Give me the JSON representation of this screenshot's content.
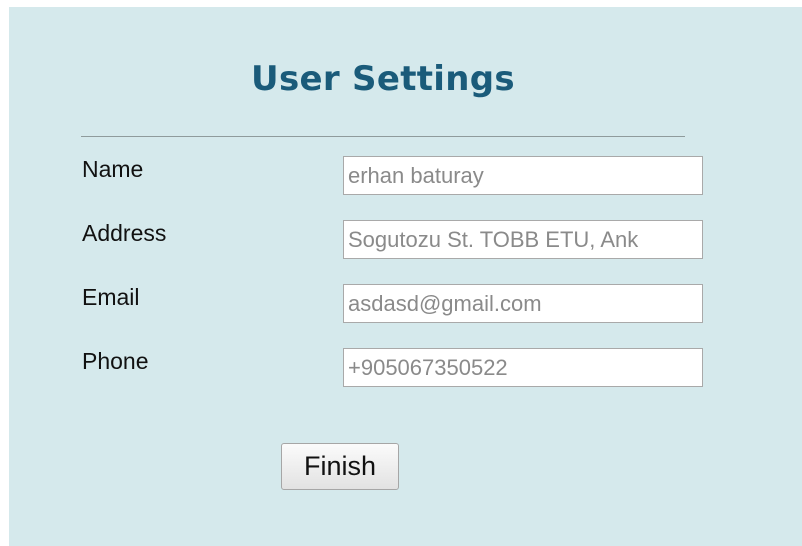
{
  "page": {
    "title": "User Settings",
    "background": "#d5e9ec",
    "title_color": "#1a5b7a"
  },
  "form": {
    "fields": [
      {
        "label": "Name",
        "value": "erhan baturay"
      },
      {
        "label": "Address",
        "value": "Sogutozu St. TOBB ETU, Ank"
      },
      {
        "label": "Email",
        "value": "asdasd@gmail.com"
      },
      {
        "label": "Phone",
        "value": "+905067350522"
      }
    ],
    "submit_label": "Finish"
  }
}
